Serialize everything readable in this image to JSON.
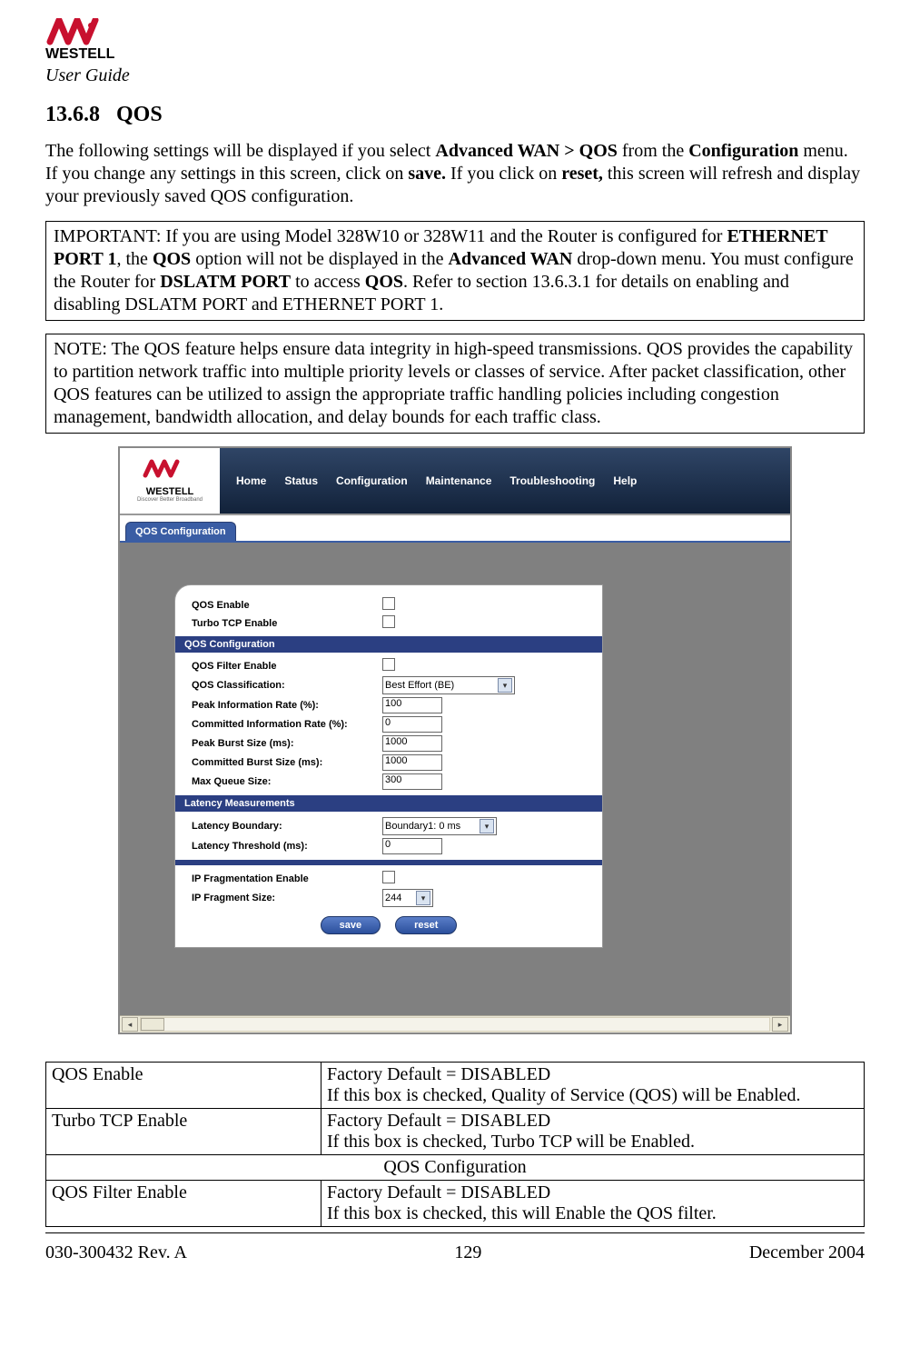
{
  "header": {
    "brand": "WESTELL",
    "guide": "User Guide"
  },
  "section": {
    "number": "13.6.8",
    "title": "QOS"
  },
  "intro": {
    "p1_pre": "The following settings will be displayed if you select ",
    "p1_b1": "Advanced WAN > QOS",
    "p1_mid1": " from the ",
    "p1_b2": "Configuration",
    "p1_mid2": " menu. If you change any settings in this screen, click on ",
    "p1_b3": "save.",
    "p1_mid3": " If you click on ",
    "p1_b4": "reset,",
    "p1_post": " this screen will refresh and display your previously saved QOS configuration."
  },
  "box1": {
    "t1": "IMPORTANT: If you are using Model 328W10 or 328W11 and the Router is configured for ",
    "b1": "ETHERNET PORT 1",
    "t2": ", the ",
    "b2": "QOS",
    "t3": " option will not be displayed in the ",
    "b3": "Advanced WAN",
    "t4": " drop-down menu. You must configure the Router for ",
    "b4": "DSLATM PORT",
    "t5": " to access ",
    "b5": "QOS",
    "t6": ". Refer to section 13.6.3.1 for details on enabling and disabling DSLATM PORT and ETHERNET PORT 1."
  },
  "box2": "NOTE: The QOS feature helps ensure data integrity in high-speed transmissions. QOS provides the capability to partition network traffic into multiple priority levels or classes of service. After packet classification, other QOS features can be utilized to assign the appropriate traffic handling policies including congestion management, bandwidth allocation, and delay bounds for each traffic class.",
  "screenshot": {
    "logo_brand": "WESTELL",
    "logo_tag": "Discover Better Broadband",
    "nav": [
      "Home",
      "Status",
      "Configuration",
      "Maintenance",
      "Troubleshooting",
      "Help"
    ],
    "tab": "QOS Configuration",
    "rows_top": [
      {
        "label": "QOS Enable",
        "type": "checkbox"
      },
      {
        "label": "Turbo TCP Enable",
        "type": "checkbox"
      }
    ],
    "bar1": "QOS Configuration",
    "rows_qos": [
      {
        "label": "QOS Filter Enable",
        "type": "checkbox"
      },
      {
        "label": "QOS Classification:",
        "type": "select",
        "value": "Best Effort (BE)"
      },
      {
        "label": "Peak Information Rate (%):",
        "type": "text",
        "value": "100"
      },
      {
        "label": "Committed Information Rate (%):",
        "type": "text",
        "value": "0"
      },
      {
        "label": "Peak Burst Size (ms):",
        "type": "text",
        "value": "1000"
      },
      {
        "label": "Committed Burst Size (ms):",
        "type": "text",
        "value": "1000"
      },
      {
        "label": "Max Queue Size:",
        "type": "text",
        "value": "300"
      }
    ],
    "bar2": "Latency Measurements",
    "rows_lat": [
      {
        "label": "Latency Boundary:",
        "type": "select",
        "value": "Boundary1: 0 ms"
      },
      {
        "label": "Latency Threshold (ms):",
        "type": "text",
        "value": "0"
      }
    ],
    "rows_ip": [
      {
        "label": "IP Fragmentation Enable",
        "type": "checkbox"
      },
      {
        "label": "IP Fragment Size:",
        "type": "select_small",
        "value": "244"
      }
    ],
    "btn_save": "save",
    "btn_reset": "reset"
  },
  "table": {
    "rows": [
      {
        "c1": "QOS Enable",
        "c2": "Factory Default = DISABLED\nIf this box is checked, Quality of Service (QOS) will be Enabled."
      },
      {
        "c1": "Turbo TCP Enable",
        "c2": "Factory Default = DISABLED\nIf this box is checked, Turbo TCP will be Enabled."
      }
    ],
    "section": "QOS Configuration",
    "rows2": [
      {
        "c1": "QOS Filter Enable",
        "c2": "Factory Default = DISABLED\nIf this box is checked, this will Enable the QOS filter."
      }
    ]
  },
  "footer": {
    "left": "030-300432 Rev. A",
    "center": "129",
    "right": "December 2004"
  }
}
